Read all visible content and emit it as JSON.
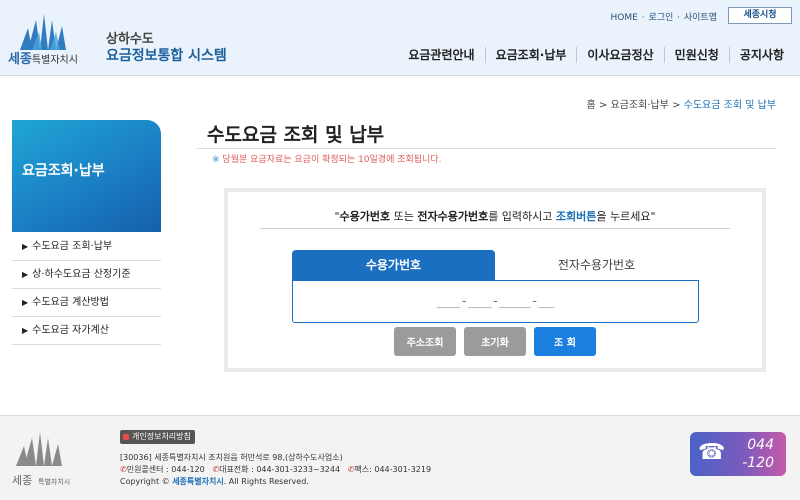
{
  "brand": {
    "city": "세종",
    "city_suffix": "특별자치시",
    "system_title_1": "상하수도",
    "system_title_2": "요금정보통합 시스템",
    "logo_icon": "sejong-emblem-icon"
  },
  "util_links": [
    "HOME",
    "로그인",
    "사이트맵"
  ],
  "sejong_button": "세종시청",
  "gnb": [
    "요금관련안내",
    "요금조회·납부",
    "이사요금정산",
    "민원신청",
    "공지사항"
  ],
  "breadcrumb": {
    "home": "홈",
    "sep": ">",
    "level1": "요금조회·납부",
    "current": "수도요금 조회 및 납부"
  },
  "sidebar": {
    "title": "요금조회·납부",
    "items": [
      "수도요금 조회·납부",
      "상·하수도요금 산정기준",
      "수도요금 계산방법",
      "수도요금 자가계산"
    ]
  },
  "content": {
    "title": "수도요금 조회 및 납부",
    "notice_mark": "※",
    "notice_text": "당월분 요금자료는 요금이 확정되는 10일경에 조회됩니다.",
    "instruction": {
      "q_open": "\"",
      "part1": "수용가번호",
      "part2": " 또는 ",
      "part3": "전자수용가번호",
      "part4": "를 입력하시고 ",
      "part5": "조회버튼",
      "part6": "을 누르세요",
      "q_close": "\""
    },
    "tabs": [
      "수용가번호",
      "전자수용가번호"
    ],
    "input_placeholder": "___-___-____-__",
    "buttons": {
      "address": "주소조회",
      "reset": "초기화",
      "search": "조 회"
    }
  },
  "footer": {
    "privacy": "개인정보처리방침",
    "address": "[30036] 세종특별자치시 조치원읍 허만석로 98,(상하수도사업소)",
    "civil_label": "민원콜센터",
    "civil_value": "044-120",
    "main_label": "대표전화",
    "main_value": "044-301-3233~3244",
    "fax_label": "팩스",
    "fax_value": "044-301-3219",
    "copyright_prefix": "Copyright ©",
    "copyright_brand": "세종특별자치시",
    "copyright_suffix": ". All Rights Reserved.",
    "call_line1": "044",
    "call_line2": "-120",
    "phone_icon": "phone-icon"
  },
  "colors": {
    "primary": "#1b6fc0",
    "header_bg": "#eaf3fb",
    "notice": "#e05a5a",
    "button_gray": "#9b9b9b",
    "button_blue": "#1b7fe0"
  }
}
